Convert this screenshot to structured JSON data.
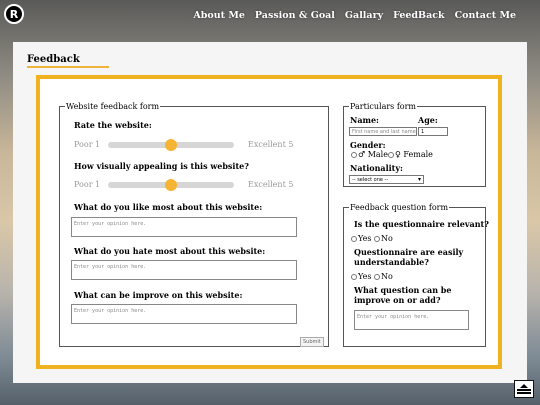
{
  "logo_letter": "R",
  "nav": {
    "items": [
      "About Me",
      "Passion & Goal",
      "Gallary",
      "FeedBack",
      "Contact Me"
    ]
  },
  "page_title": "Feedback",
  "website_feedback": {
    "legend": "Website feedback form",
    "rate_question": "Rate the website:",
    "rate_min": "Poor 1",
    "rate_max": "Excellent 5",
    "rate_value": 3,
    "visual_question": "How visually appealing is this website?",
    "visual_min": "Poor 1",
    "visual_max": "Excellent 5",
    "visual_value": 3,
    "like_question": "What do you like most about this website:",
    "like_placeholder": "Enter your opinion here.",
    "hate_question": "What do you hate most about this website:",
    "hate_placeholder": "Enter your opinion here.",
    "improve_question": "What can be improve on this website:",
    "improve_placeholder": "Enter your opinion here.",
    "submit_label": "Submit"
  },
  "particulars": {
    "legend": "Particulars form",
    "name_label": "Name:",
    "name_placeholder": "First name and last name",
    "age_label": "Age:",
    "age_value": "1",
    "gender_label": "Gender:",
    "male_label": "♂ Male",
    "female_label": "♀ Female",
    "nationality_label": "Nationality:",
    "nationality_selected": "-- select one --"
  },
  "feedback_question": {
    "legend": "Feedback question form",
    "q1": "Is the questionnaire relevant?",
    "q2": "Questionnaire are easily understandable?",
    "q3": "What question can be improve on or add?",
    "yes_label": "Yes",
    "no_label": "No",
    "q3_placeholder": "Enter your opinion here."
  }
}
